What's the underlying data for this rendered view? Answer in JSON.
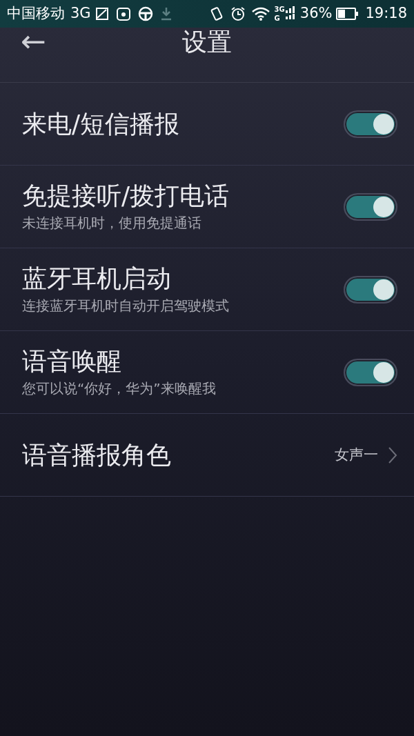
{
  "status_bar": {
    "carrier": "中国移动",
    "network": "3G",
    "signal_top": "3G",
    "signal_bottom": "G",
    "battery": "36%",
    "time": "19:18"
  },
  "header": {
    "back": "←",
    "title": "设置"
  },
  "settings": [
    {
      "kind": "toggle",
      "title": "来电/短信播报",
      "on": true
    },
    {
      "kind": "toggle",
      "title": "免提接听/拨打电话",
      "subtitle": "未连接耳机时，使用免提通话",
      "on": true
    },
    {
      "kind": "toggle",
      "title": "蓝牙耳机启动",
      "subtitle": "连接蓝牙耳机时自动开启驾驶模式",
      "on": true
    },
    {
      "kind": "toggle",
      "title": "语音唤醒",
      "subtitle": "您可以说“你好，华为”来唤醒我",
      "on": true
    },
    {
      "kind": "link",
      "title": "语音播报角色",
      "value": "女声一"
    }
  ]
}
